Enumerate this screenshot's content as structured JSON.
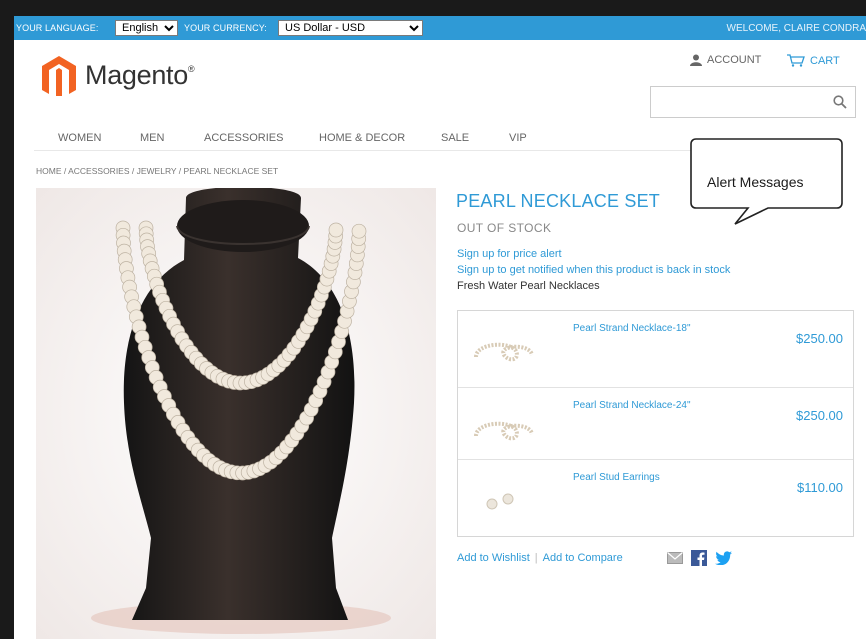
{
  "topbar": {
    "language_label": "YOUR LANGUAGE:",
    "language_value": "English",
    "currency_label": "YOUR CURRENCY:",
    "currency_value": "US Dollar - USD",
    "welcome": "WELCOME, CLAIRE CONDRA"
  },
  "header": {
    "logo_text": "Magento",
    "account_label": "ACCOUNT",
    "cart_label": "CART",
    "search_placeholder": ""
  },
  "nav": {
    "items": [
      "WOMEN",
      "MEN",
      "ACCESSORIES",
      "HOME & DECOR",
      "SALE",
      "VIP"
    ]
  },
  "breadcrumb": "HOME / ACCESSORIES / JEWELRY / PEARL NECKLACE SET",
  "product": {
    "title": "PEARL NECKLACE SET",
    "stock_status": "OUT OF STOCK",
    "price_alert_link": "Sign up for price alert",
    "stock_alert_link": "Sign up to get notified when this product is back in stock",
    "short_description": "Fresh Water Pearl Necklaces",
    "grouped_items": [
      {
        "name": "Pearl Strand Necklace-18\"",
        "price": "$250.00"
      },
      {
        "name": "Pearl Strand Necklace-24\"",
        "price": "$250.00"
      },
      {
        "name": "Pearl Stud Earrings",
        "price": "$110.00"
      }
    ],
    "add_to_wishlist": "Add to Wishlist",
    "add_to_compare": "Add to Compare"
  },
  "callout": {
    "text": "Alert Messages"
  },
  "colors": {
    "accent": "#2f9ad6",
    "logo_orange": "#f26322"
  },
  "icons": [
    "user-icon",
    "cart-icon",
    "search-icon",
    "email-icon",
    "facebook-icon",
    "twitter-icon"
  ]
}
